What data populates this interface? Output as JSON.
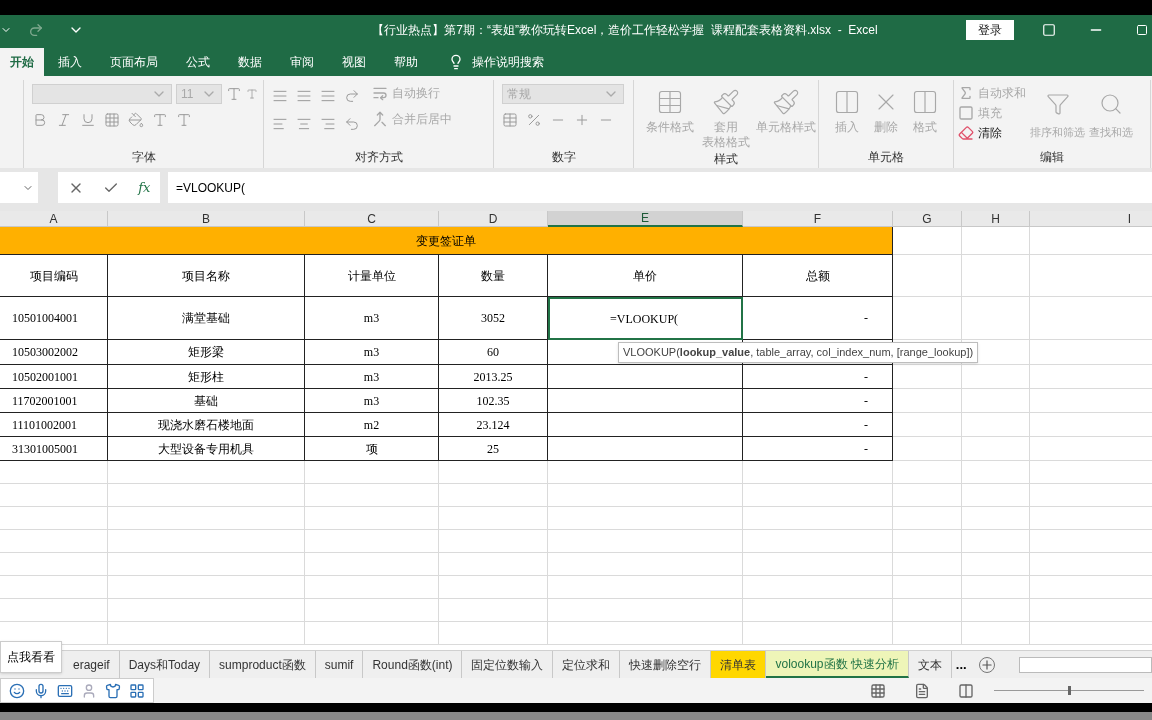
{
  "title_bar": {
    "title": "【行业热点】第7期：“表姐”教你玩转Excel，造价工作轻松学握  课程配套表格资料.xlsx  -  Excel",
    "login": "登录"
  },
  "ribbon_tabs": [
    {
      "label": "开始",
      "selected": true
    },
    {
      "label": "插入",
      "selected": false
    },
    {
      "label": "页面布局",
      "selected": false
    },
    {
      "label": "公式",
      "selected": false
    },
    {
      "label": "数据",
      "selected": false
    },
    {
      "label": "审阅",
      "selected": false
    },
    {
      "label": "视图",
      "selected": false
    },
    {
      "label": "帮助",
      "selected": false
    }
  ],
  "tell_me": "操作说明搜索",
  "ribbon": {
    "font_group": {
      "label": "字体",
      "font_size": "11"
    },
    "alignment_group": {
      "label": "对齐方式",
      "commands": [
        {
          "label": "自动换行",
          "disabled": true
        },
        {
          "label": "合并后居中",
          "disabled": true
        }
      ]
    },
    "number_group": {
      "label": "数字",
      "format": "常规"
    },
    "styles_group": {
      "label": "样式",
      "commands": [
        {
          "label": "条件格式",
          "disabled": true
        },
        {
          "lines": [
            "套用",
            "表格格式"
          ],
          "disabled": true
        },
        {
          "label": "单元格样式",
          "disabled": true
        }
      ]
    },
    "cells_group": {
      "label": "单元格",
      "commands": [
        {
          "label": "插入",
          "disabled": true
        },
        {
          "label": "删除",
          "disabled": true
        },
        {
          "label": "格式",
          "disabled": true
        }
      ]
    },
    "editing_group": {
      "label": "编辑",
      "commands": [
        {
          "label": "自动求和",
          "disabled": true
        },
        {
          "label": "填充",
          "disabled": true
        },
        {
          "label": "清除",
          "disabled": false
        }
      ],
      "sort": {
        "label": "排序和筛选",
        "disabled": true
      },
      "find": {
        "label": "查找和选",
        "disabled": true
      }
    }
  },
  "formula_bar": {
    "insert_function": "fx",
    "formula": "=VLOOKUP("
  },
  "zoom": {
    "level": 0.5
  },
  "sheet": {
    "columns": [
      {
        "label": "A",
        "selected": false
      },
      {
        "label": "B",
        "selected": false
      },
      {
        "label": "C",
        "selected": false
      },
      {
        "label": "D",
        "selected": false
      },
      {
        "label": "E",
        "selected": true
      },
      {
        "label": "F",
        "selected": false
      },
      {
        "label": "G",
        "selected": false
      },
      {
        "label": "H",
        "selected": false
      },
      {
        "label": "I",
        "selected": false
      }
    ],
    "title": "变更签证单",
    "headers": [
      "项目编码",
      "项目名称",
      "计量单位",
      "数量",
      "单价",
      "总额"
    ],
    "rows": [
      {
        "code": "10501004001",
        "name": "满堂基础",
        "unit": "m3",
        "qty": "3052",
        "price": "=VLOOKUP(",
        "total": "-",
        "editing": true
      },
      {
        "code": "10503002002",
        "name": "矩形梁",
        "unit": "m3",
        "qty": "60",
        "editing": false
      },
      {
        "code": "10502001001",
        "name": "矩形柱",
        "unit": "m3",
        "qty": "2013.25",
        "total": "-",
        "editing": false
      },
      {
        "code": "11702001001",
        "name": "基础",
        "unit": "m3",
        "qty": "102.35",
        "total": "-",
        "editing": false
      },
      {
        "code": "11101002001",
        "name": "现浇水磨石楼地面",
        "unit": "m2",
        "qty": "23.124",
        "total": "-",
        "editing": false
      },
      {
        "code": "31301005001",
        "name": "大型设备专用机具",
        "unit": "项",
        "qty": "25",
        "total": "-",
        "editing": false
      }
    ],
    "tooltip": "VLOOKUP(**lookup_value**, table_array, col_index_num, [range_lookup])"
  },
  "sheet_tabs": [
    {
      "label": "erageif",
      "selected": false
    },
    {
      "label": "Days和Today",
      "selected": false
    },
    {
      "label": "sumproduct函数",
      "selected": false
    },
    {
      "label": "sumif",
      "selected": false
    },
    {
      "label": "Round函数(int)",
      "selected": false
    },
    {
      "label": "固定位数输入",
      "selected": false
    },
    {
      "label": "定位求和",
      "selected": false
    },
    {
      "label": "快速删除空行",
      "selected": false
    },
    {
      "label": "清单表",
      "selected": false,
      "color": "#ffd700"
    },
    {
      "label": "volookup函数 快速分析",
      "selected": true,
      "color": "#eef5b8"
    },
    {
      "label": "文本",
      "selected": false
    }
  ],
  "more_tabs": "...",
  "popup": "点我看看"
}
